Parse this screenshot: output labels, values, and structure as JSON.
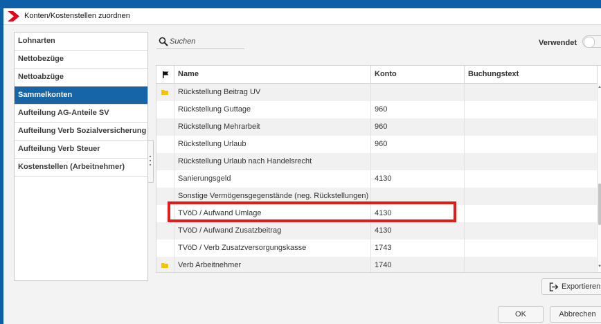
{
  "window": {
    "title": "Konten/Kostenstellen zuordnen"
  },
  "sidebar": {
    "items": [
      {
        "label": "Lohnarten",
        "active": false
      },
      {
        "label": "Nettobezüge",
        "active": false
      },
      {
        "label": "Nettoabzüge",
        "active": false
      },
      {
        "label": "Sammelkonten",
        "active": true
      },
      {
        "label": "Aufteilung AG-Anteile SV",
        "active": false
      },
      {
        "label": "Aufteilung Verb Sozialversicherung",
        "active": false
      },
      {
        "label": "Aufteilung Verb Steuer",
        "active": false
      },
      {
        "label": "Kostenstellen (Arbeitnehmer)",
        "active": false
      }
    ]
  },
  "search": {
    "placeholder": "Suchen",
    "value": ""
  },
  "filter": {
    "used_label": "Verwendet",
    "used_on": false
  },
  "table": {
    "columns": {
      "name": "Name",
      "konto": "Konto",
      "buchungstext": "Buchungstext"
    },
    "rows": [
      {
        "name": "Rückstellung Beitrag UV",
        "konto": "",
        "buchungstext": "",
        "flagged": true
      },
      {
        "name": "Rückstellung Guttage",
        "konto": "960",
        "buchungstext": "",
        "flagged": false
      },
      {
        "name": "Rückstellung Mehrarbeit",
        "konto": "960",
        "buchungstext": "",
        "flagged": false
      },
      {
        "name": "Rückstellung Urlaub",
        "konto": "960",
        "buchungstext": "",
        "flagged": false
      },
      {
        "name": "Rückstellung Urlaub nach Handelsrecht",
        "konto": "",
        "buchungstext": "",
        "flagged": false
      },
      {
        "name": "Sanierungsgeld",
        "konto": "4130",
        "buchungstext": "",
        "flagged": false
      },
      {
        "name": "Sonstige Vermögensgegenstände (neg. Rückstellungen)",
        "konto": "",
        "buchungstext": "",
        "flagged": false
      },
      {
        "name": "TVöD / Aufwand Umlage",
        "konto": "4130",
        "buchungstext": "",
        "flagged": false
      },
      {
        "name": "TVöD / Aufwand Zusatzbeitrag",
        "konto": "4130",
        "buchungstext": "",
        "flagged": false
      },
      {
        "name": "TVöD / Verb Zusatzversorgungskasse",
        "konto": "1743",
        "buchungstext": "",
        "flagged": false
      },
      {
        "name": "Verb Arbeitnehmer",
        "konto": "1740",
        "buchungstext": "",
        "flagged": true
      }
    ]
  },
  "buttons": {
    "export": "Exportieren",
    "ok": "OK",
    "cancel": "Abbrechen"
  },
  "colors": {
    "accent": "#1565a8",
    "window_border": "#0d5fa8",
    "logo_red": "#e2001a",
    "flag_yellow": "#f5c400",
    "highlight_red": "#e21b1b"
  },
  "icons": {
    "logo": "chevron-logo",
    "search": "search-icon",
    "header_flag": "flag-icon",
    "row_flag": "folder-flag-icon",
    "export": "export-icon"
  }
}
